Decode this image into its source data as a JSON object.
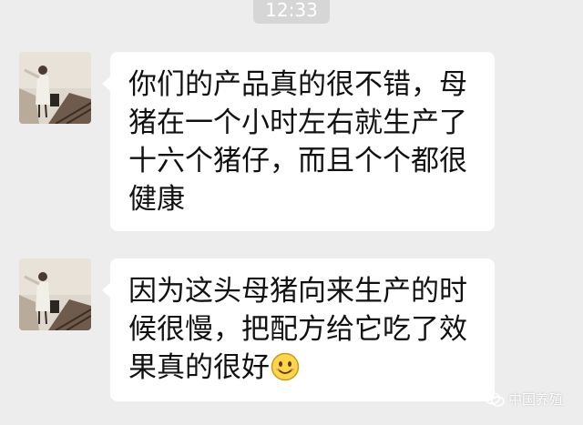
{
  "status": {
    "time": "12:33"
  },
  "messages": [
    {
      "lines": [
        "你们的产品真的很不错，母",
        "猪在一个小时左右就生产了",
        "十六个猪仔，而且个个都很",
        "健康"
      ]
    },
    {
      "lines": [
        "因为这头母猪向来生产的时",
        "候很慢，把配方给它吃了效",
        "果真的很好"
      ],
      "emoji": "smile-emoji"
    }
  ],
  "watermark": {
    "text": "中国养殖",
    "icon": "wechat-icon"
  },
  "colors": {
    "background": "#ededed",
    "bubble": "#ffffff",
    "text": "#111111",
    "timestamp_bg": "#d6d6d6"
  }
}
